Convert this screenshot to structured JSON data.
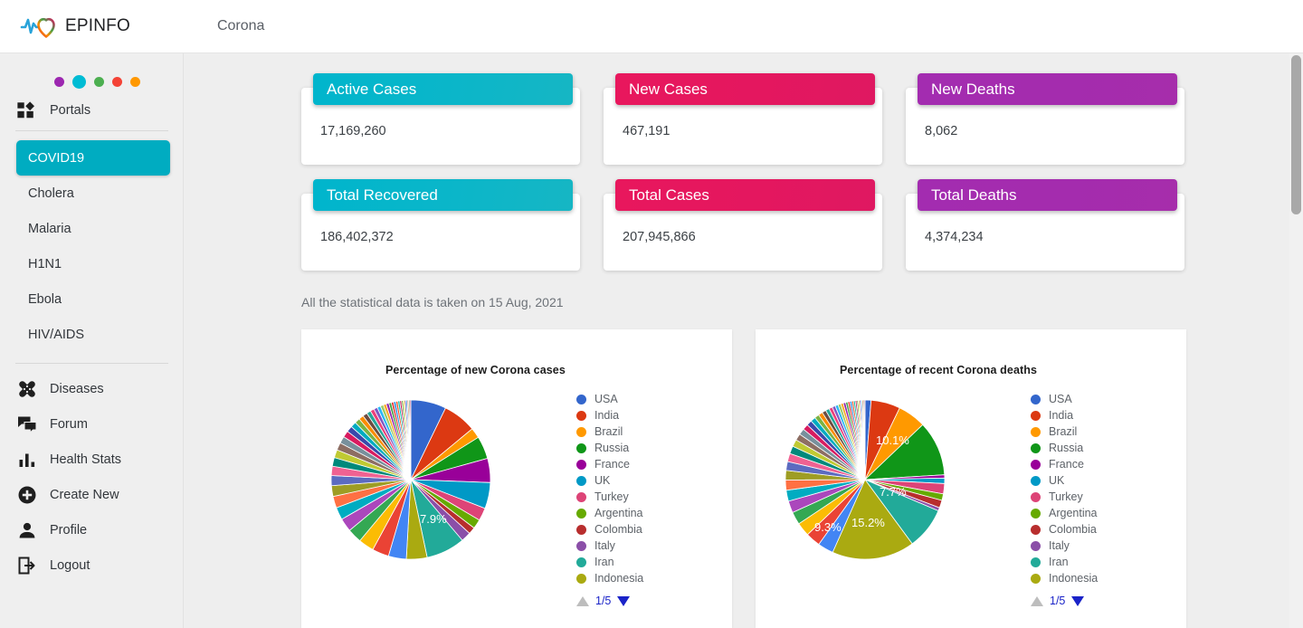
{
  "header": {
    "brand": "EPINFO",
    "logo_icon": "heart-pulse-icon",
    "nav_item": "Corona"
  },
  "sidebar": {
    "dots": [
      {
        "color": "#9c27b0",
        "name": "dot-purple"
      },
      {
        "color": "#00bcd4",
        "name": "dot-cyan"
      },
      {
        "color": "#4caf50",
        "name": "dot-green"
      },
      {
        "color": "#f44336",
        "name": "dot-red"
      },
      {
        "color": "#ff9800",
        "name": "dot-orange"
      }
    ],
    "portals_label": "Portals",
    "portals_icon": "grid-apps-icon",
    "portals": [
      {
        "label": "COVID19",
        "active": true
      },
      {
        "label": "Cholera",
        "active": false
      },
      {
        "label": "Malaria",
        "active": false
      },
      {
        "label": "H1N1",
        "active": false
      },
      {
        "label": "Ebola",
        "active": false
      },
      {
        "label": "HIV/AIDS",
        "active": false
      }
    ],
    "menu": [
      {
        "label": "Diseases",
        "icon": "bandage-icon"
      },
      {
        "label": "Forum",
        "icon": "chat-bubbles-icon"
      },
      {
        "label": "Health Stats",
        "icon": "bar-chart-icon"
      },
      {
        "label": "Create New",
        "icon": "plus-circle-icon"
      },
      {
        "label": "Profile",
        "icon": "person-icon"
      },
      {
        "label": "Logout",
        "icon": "logout-arrow-icon"
      }
    ]
  },
  "stats": {
    "cards": [
      {
        "title": "Active Cases",
        "value": "17,169,260",
        "color": "teal",
        "hex": "#00b5cc"
      },
      {
        "title": "New Cases",
        "value": "467,191",
        "color": "pink",
        "hex": "#e8175d"
      },
      {
        "title": "New Deaths",
        "value": "8,062",
        "color": "purple",
        "hex": "#a32cb0"
      },
      {
        "title": "Total Recovered",
        "value": "186,402,372",
        "color": "teal",
        "hex": "#00b5cc"
      },
      {
        "title": "Total Cases",
        "value": "207,945,866",
        "color": "pink",
        "hex": "#e8175d"
      },
      {
        "title": "Total Deaths",
        "value": "4,374,234",
        "color": "purple",
        "hex": "#a32cb0"
      }
    ],
    "note": "All the statistical data is taken on 15 Aug, 2021"
  },
  "legend_pager": {
    "current": "1/5",
    "up_icon": "triangle-up-icon",
    "down_icon": "triangle-down-icon"
  },
  "chart_data": [
    {
      "type": "pie",
      "title": "Percentage of new Corona cases",
      "legend_position": "right",
      "categories": [
        "USA",
        "India",
        "Brazil",
        "Russia",
        "France",
        "UK",
        "Turkey",
        "Argentina",
        "Colombia",
        "Italy",
        "Iran",
        "Indonesia"
      ],
      "colors": [
        "#3366cc",
        "#dc3912",
        "#ff9900",
        "#109618",
        "#990099",
        "#0099c6",
        "#dd4477",
        "#66aa00",
        "#b82e2e",
        "#8b4fa8",
        "#22aa99",
        "#aaaa11"
      ],
      "values": [
        7.2,
        6.8,
        2.1,
        4.6,
        4.9,
        5.3,
        2.6,
        1.9,
        1.4,
        2.0,
        7.9,
        4.2
      ],
      "labels_shown": [
        {
          "value": "7.9%",
          "category": "Iran"
        }
      ],
      "other_slices": 49.1
    },
    {
      "type": "pie",
      "title": "Percentage of recent Corona deaths",
      "legend_position": "right",
      "categories": [
        "USA",
        "India",
        "Brazil",
        "Russia",
        "France",
        "UK",
        "Turkey",
        "Argentina",
        "Colombia",
        "Italy",
        "Iran",
        "Indonesia"
      ],
      "colors": [
        "#3366cc",
        "#dc3912",
        "#ff9900",
        "#109618",
        "#990099",
        "#0099c6",
        "#dd4477",
        "#66aa00",
        "#b82e2e",
        "#8b4fa8",
        "#22aa99",
        "#aaaa11"
      ],
      "values": [
        1.1,
        5.4,
        5.2,
        10.1,
        0.6,
        1.0,
        1.9,
        1.2,
        1.4,
        0.6,
        7.7,
        15.2
      ],
      "labels_shown": [
        {
          "value": "10.1%",
          "category": "Russia"
        },
        {
          "value": "7.7%",
          "category": "Iran"
        },
        {
          "value": "15.2%",
          "category": "Indonesia"
        },
        {
          "value": "9.3%",
          "category": "Brazil-other"
        }
      ],
      "other_slices": 39.3
    }
  ]
}
